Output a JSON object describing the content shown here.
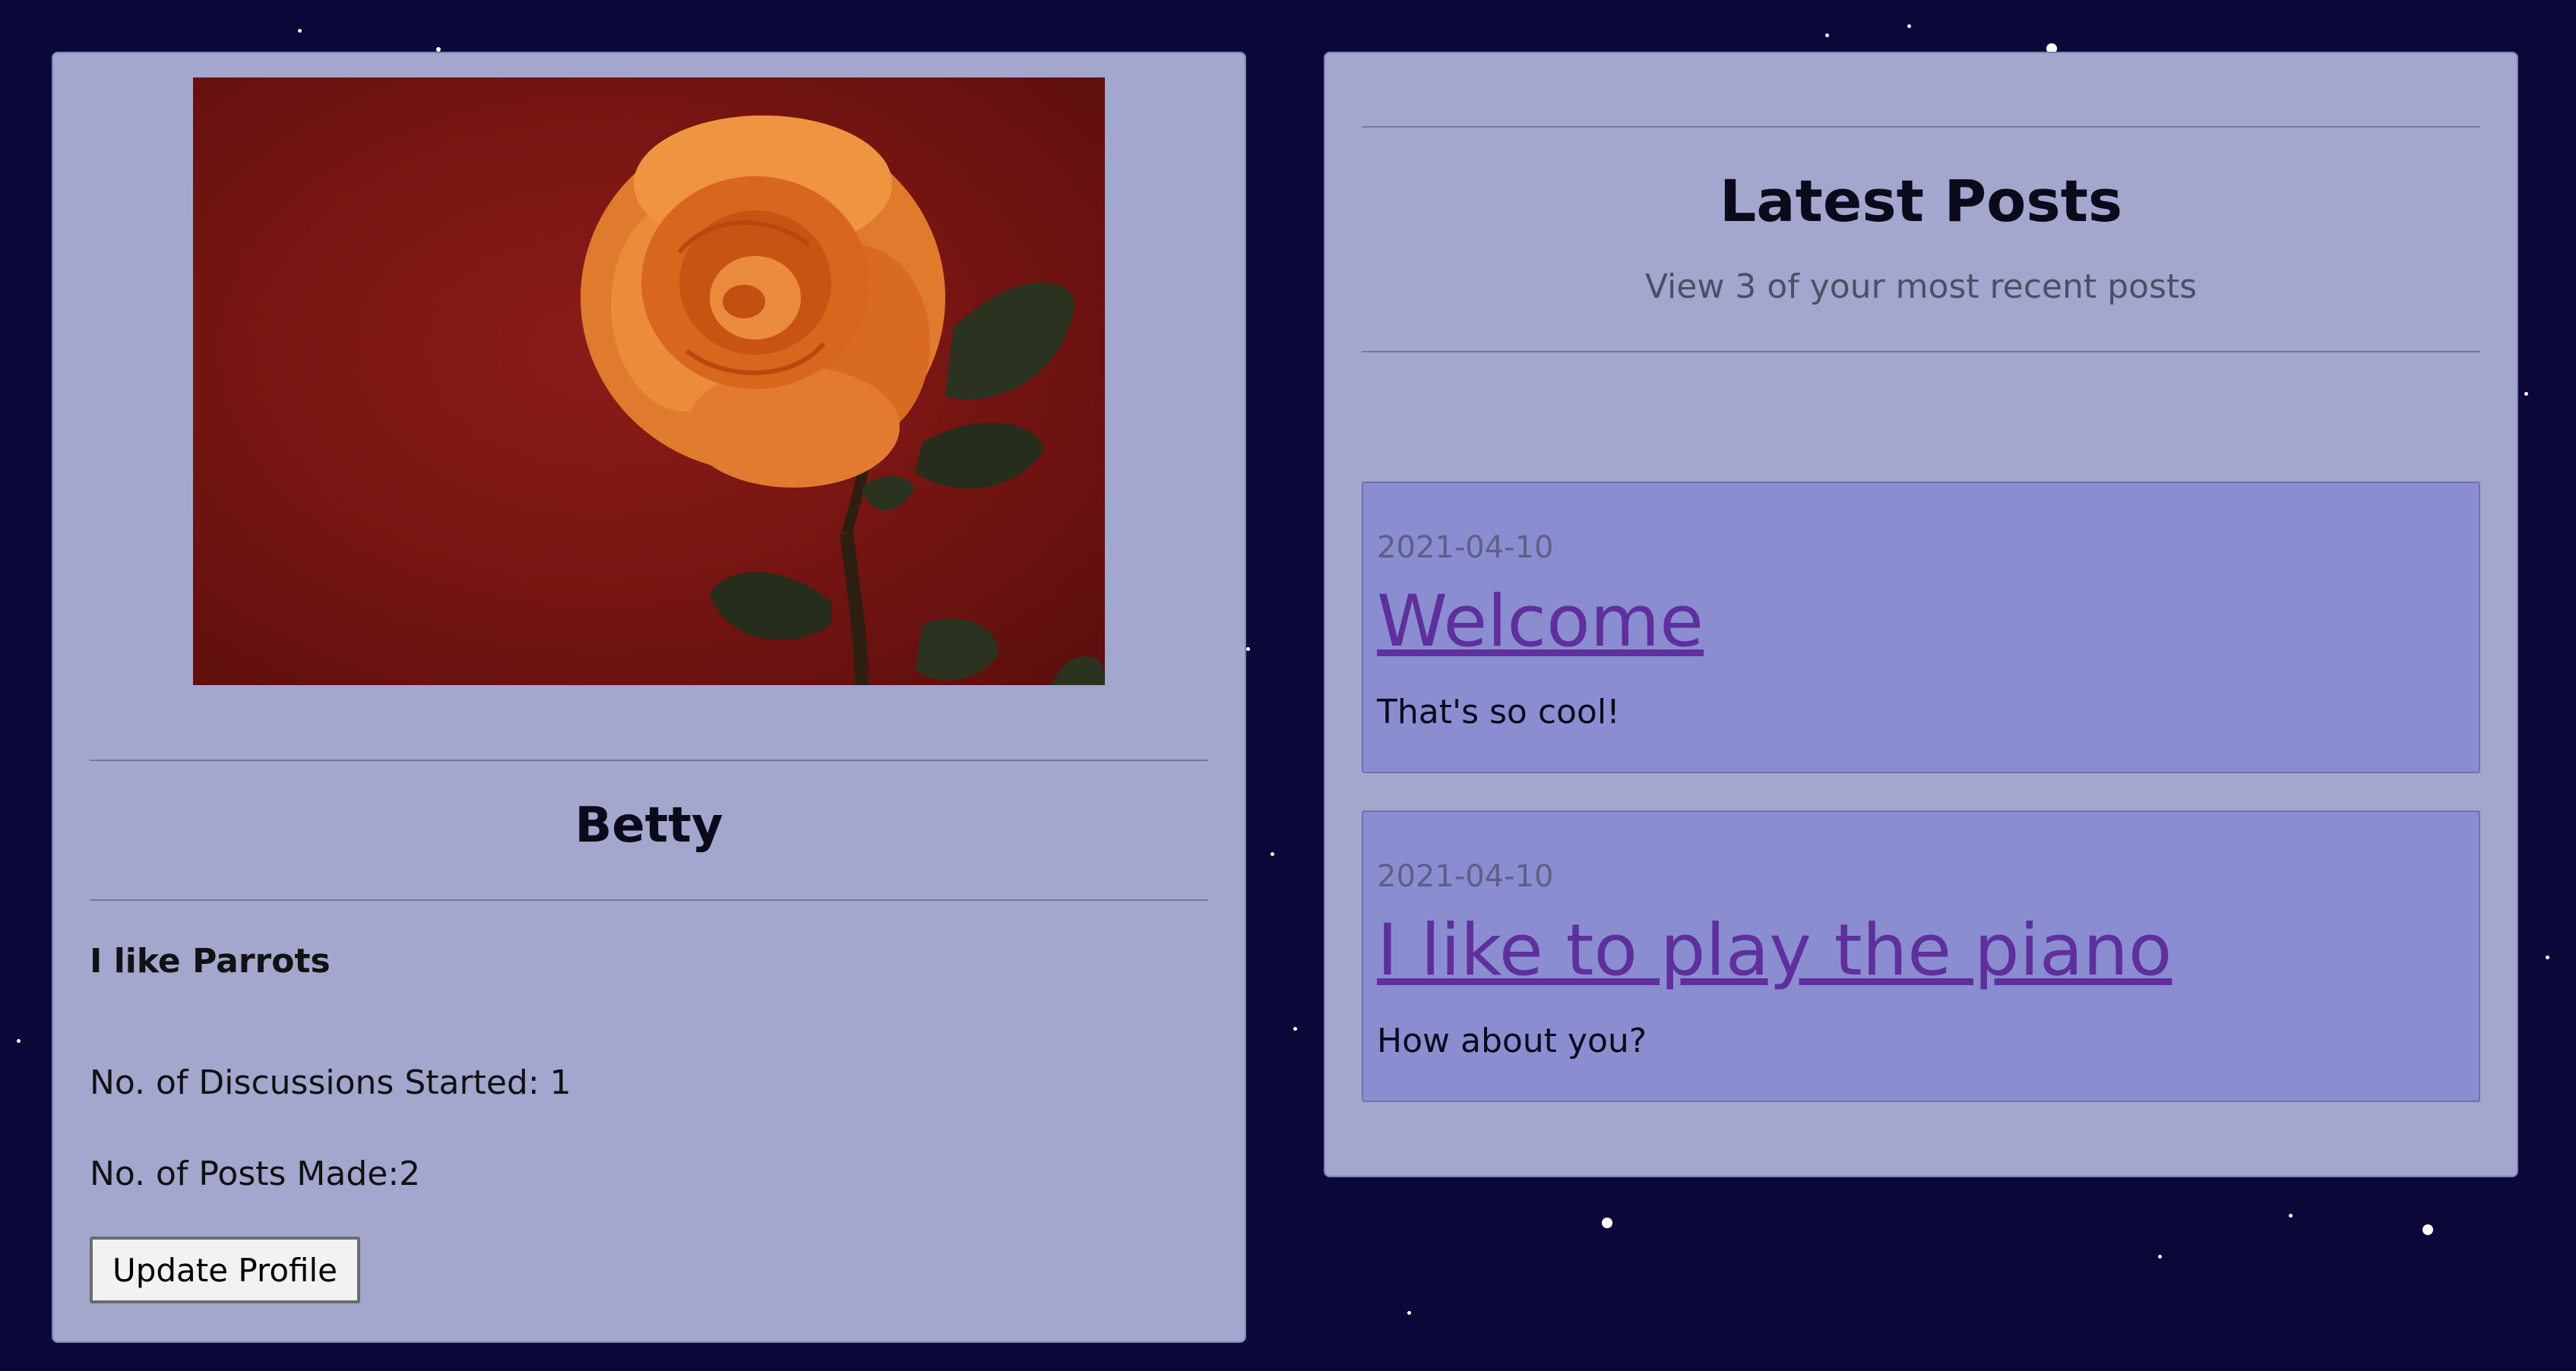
{
  "profile": {
    "photo_alt": "orange rose",
    "username": "Betty",
    "bio": "I like Parrots",
    "stats": {
      "discussions": "No. of Discussions Started: 1",
      "posts": "No. of Posts Made:2"
    },
    "update_button": "Update Profile"
  },
  "latest_posts": {
    "title": "Latest Posts",
    "subtitle": "View 3 of your most recent posts",
    "posts": [
      {
        "date": "2021-04-10",
        "title": "Welcome",
        "body": "That's so cool!"
      },
      {
        "date": "2021-04-10",
        "title": "I like to play the piano",
        "body": "How about you?"
      }
    ]
  },
  "colors": {
    "background": "#0c0739",
    "card": "#a3a6cd",
    "post_card": "#8a8dd0",
    "link": "#5f2f9d"
  }
}
